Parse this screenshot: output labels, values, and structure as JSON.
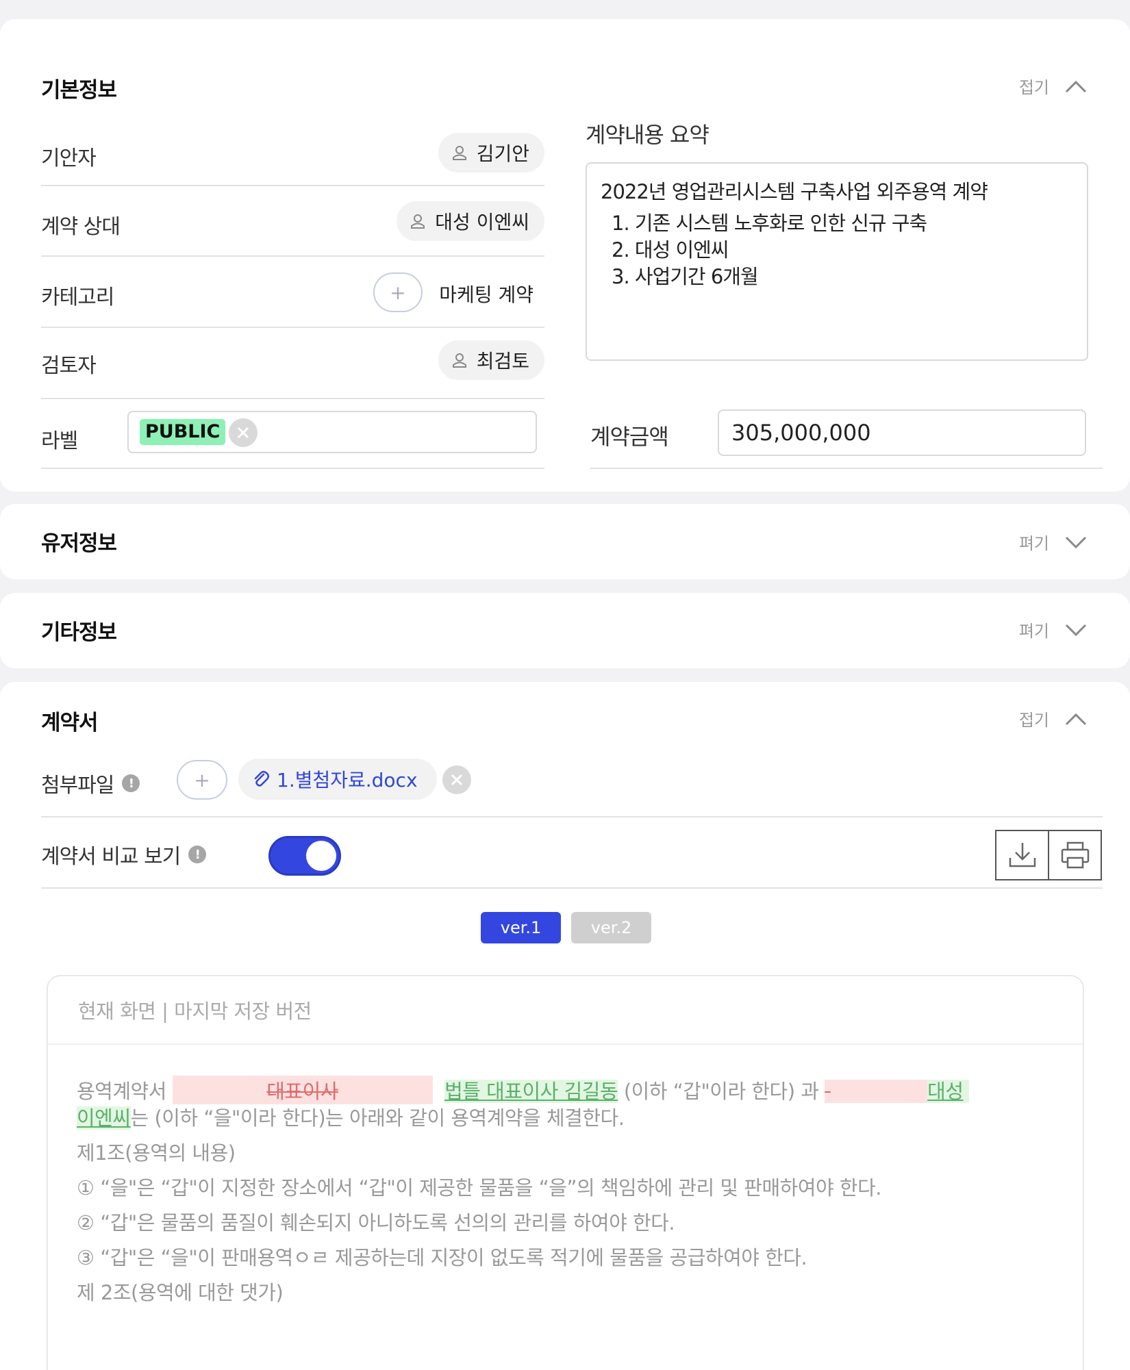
{
  "basic_info": {
    "title": "기본정보",
    "collapse_label": "접기",
    "drafter": {
      "label": "기안자",
      "value": "김기안"
    },
    "counterparty": {
      "label": "계약 상대",
      "value": "대성 이엔씨"
    },
    "category": {
      "label": "카테고리",
      "value": "마케팅 계약",
      "add_symbol": "+"
    },
    "reviewer": {
      "label": "검토자",
      "value": "최검토"
    },
    "tag_label": {
      "label": "라벨",
      "tag": "PUBLIC"
    },
    "summary": {
      "label": "계약내용 요약",
      "heading": "2022년 영업관리시스템 구축사업 외주용역 계약",
      "items": [
        "1. 기존 시스템 노후화로 인한 신규 구축",
        "2. 대성 이엔씨",
        "3. 사업기간 6개월"
      ]
    },
    "amount": {
      "label": "계약금액",
      "value": "305,000,000"
    }
  },
  "user_info": {
    "title": "유저정보",
    "expand_label": "펴기"
  },
  "other_info": {
    "title": "기타정보",
    "expand_label": "펴기"
  },
  "contract": {
    "title": "계약서",
    "collapse_label": "접기",
    "attachment": {
      "label": "첨부파일",
      "add_symbol": "+",
      "file_name": "1.별첨자료.docx"
    },
    "compare": {
      "label": "계약서 비교 보기",
      "enabled": true
    },
    "versions": [
      "ver.1",
      "ver.2"
    ],
    "viewer": {
      "header": "현재 화면 | 마지막 저장 버전",
      "line1_prefix": "용역계약서 ",
      "line1_deleted1": "대표이사",
      "line1_inserted1": "법틀 대표이사 김길동",
      "line1_middle": " (이하 “갑\"이라 한다) 과 ",
      "line1_inserted2": "대성",
      "line2_inserted": "이엔씨",
      "line2_rest": "는 (이하 “을\"이라 한다)는 아래와 같이 용역계약을 체결한다.",
      "lines": [
        "제1조(용역의 내용)",
        "① “을\"은 “갑\"이 지정한 장소에서 “갑\"이 제공한 물품을 “을”의 책임하에 관리 및 판매하여야 한다.",
        "② “갑\"은 물품의 품질이 훼손되지 아니하도록 선의의 관리를 하여야 한다.",
        "③ “갑\"은 “을\"이 판매용역ㅇㄹ 제공하는데 지장이 없도록 적기에 물품을 공급하여야 한다.",
        "제 2조(용역에 대한 댓가)"
      ]
    }
  }
}
